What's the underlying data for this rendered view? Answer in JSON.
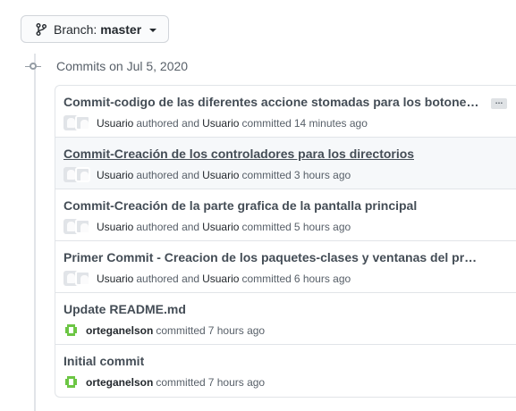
{
  "branch": {
    "prefix": "Branch:",
    "name": "master",
    "icon": "git-branch-icon"
  },
  "date_heading": "Commits on Jul 5, 2020",
  "commits": [
    {
      "title": "Commit-codigo de las diferentes accione stomadas para los botones de ...",
      "author": "Usuario",
      "authored_word": "authored and",
      "committer": "Usuario",
      "committed_word": "committed",
      "time": "14 minutes ago"
    },
    {
      "title": "Commit-Creación de los controladores para los directorios",
      "author": "Usuario",
      "authored_word": "authored and",
      "committer": "Usuario",
      "committed_word": "committed",
      "time": "3 hours ago"
    },
    {
      "title": "Commit-Creación de la parte grafica de la pantalla principal",
      "author": "Usuario",
      "authored_word": "authored and",
      "committer": "Usuario",
      "committed_word": "committed",
      "time": "5 hours ago"
    },
    {
      "title": "Primer Commit - Creacion de los paquetes-clases y ventanas del proyecto",
      "author": "Usuario",
      "authored_word": "authored and",
      "committer": "Usuario",
      "committed_word": "committed",
      "time": "6 hours ago"
    },
    {
      "title": "Update README.md",
      "committer": "orteganelson",
      "committed_word": "committed",
      "time": "7 hours ago"
    },
    {
      "title": "Initial commit",
      "committer": "orteganelson",
      "committed_word": "committed",
      "time": "7 hours ago"
    }
  ],
  "ellipsis_label": "…",
  "colors": {
    "border": "#e1e4e8",
    "muted": "#586069",
    "highlight_row": "#f6f8fa",
    "avatar_green": "#6cc644"
  }
}
